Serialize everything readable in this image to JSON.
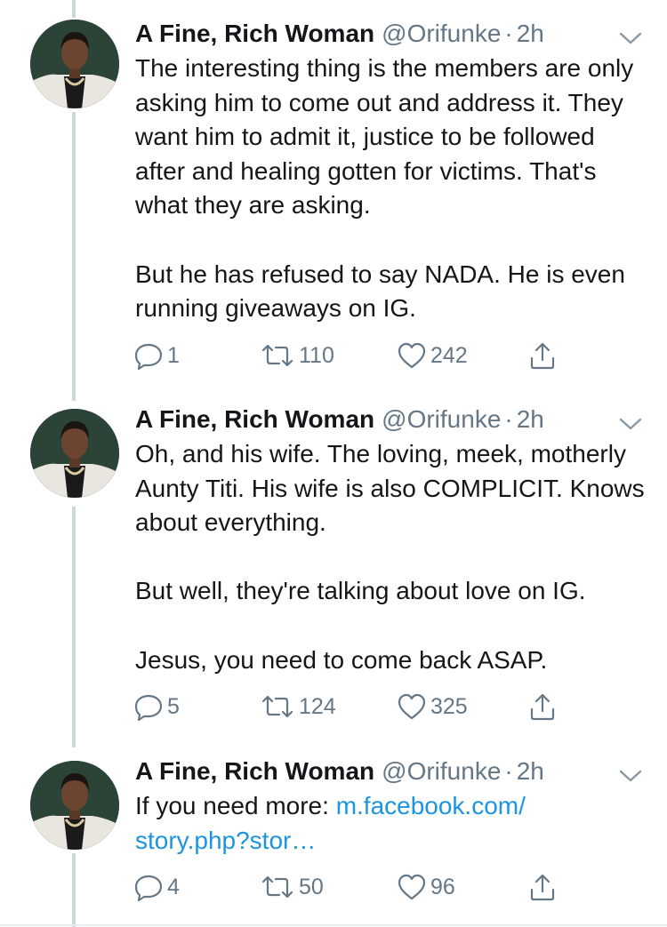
{
  "tweets": [
    {
      "author_name": "A Fine, Rich Woman",
      "handle": "@Orifunke",
      "separator": "·",
      "time": "2h",
      "paragraphs": [
        "The interesting thing is the members are only asking him to come out and address it. They want him to admit it, justice to be followed after and healing gotten for victims. That's what they are asking.",
        "But he has refused to say NADA. He is even running giveaways on IG."
      ],
      "replies": "1",
      "retweets": "110",
      "likes": "242"
    },
    {
      "author_name": "A Fine, Rich Woman",
      "handle": "@Orifunke",
      "separator": "·",
      "time": "2h",
      "paragraphs": [
        "Oh, and his wife. The loving, meek, motherly Aunty Titi. His wife is also COMPLICIT. Knows about everything.",
        "But well, they're talking about love on IG.",
        "Jesus, you need to come back ASAP."
      ],
      "replies": "5",
      "retweets": "124",
      "likes": "325"
    },
    {
      "author_name": "A Fine, Rich Woman",
      "handle": "@Orifunke",
      "separator": "·",
      "time": "2h",
      "text_prefix": "If you need more: ",
      "link_text": "m.facebook.com/ story.php?stor…",
      "replies": "4",
      "retweets": "50",
      "likes": "96"
    }
  ],
  "icons": {
    "reply": "reply-icon",
    "retweet": "retweet-icon",
    "like": "heart-icon",
    "share": "share-icon",
    "caret": "chevron-down-icon"
  },
  "colors": {
    "text": "#14171a",
    "secondary": "#657786",
    "link": "#1b95e0",
    "thread_line": "#ccd6dd"
  }
}
